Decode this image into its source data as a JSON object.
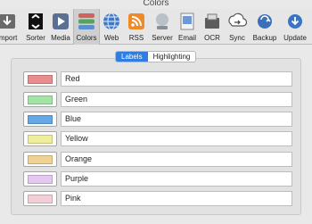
{
  "window": {
    "title": "Colors"
  },
  "toolbar": {
    "items": [
      {
        "label": "Import",
        "icon": "import-icon"
      },
      {
        "label": "Sorter",
        "icon": "sorter-icon"
      },
      {
        "label": "Media",
        "icon": "media-icon"
      },
      {
        "label": "Colors",
        "icon": "colors-icon",
        "active": true
      },
      {
        "label": "Web",
        "icon": "globe-icon"
      },
      {
        "label": "RSS",
        "icon": "rss-icon"
      },
      {
        "label": "Server",
        "icon": "server-icon"
      },
      {
        "label": "Email",
        "icon": "email-icon"
      },
      {
        "label": "OCR",
        "icon": "ocr-icon"
      },
      {
        "label": "Sync",
        "icon": "sync-icon"
      },
      {
        "label": "Backup",
        "icon": "backup-icon"
      },
      {
        "label": "Update",
        "icon": "update-icon"
      }
    ]
  },
  "tabs": [
    {
      "label": "Labels",
      "active": true
    },
    {
      "label": "Highlighting",
      "active": false
    }
  ],
  "colors": [
    {
      "name": "Red",
      "swatch": "#e88c8e"
    },
    {
      "name": "Green",
      "swatch": "#a4e3a6"
    },
    {
      "name": "Blue",
      "swatch": "#66a8e6"
    },
    {
      "name": "Yellow",
      "swatch": "#eeee9c"
    },
    {
      "name": "Orange",
      "swatch": "#f0d294"
    },
    {
      "name": "Purple",
      "swatch": "#e5c7f1"
    },
    {
      "name": "Pink",
      "swatch": "#f2cfd7"
    }
  ]
}
